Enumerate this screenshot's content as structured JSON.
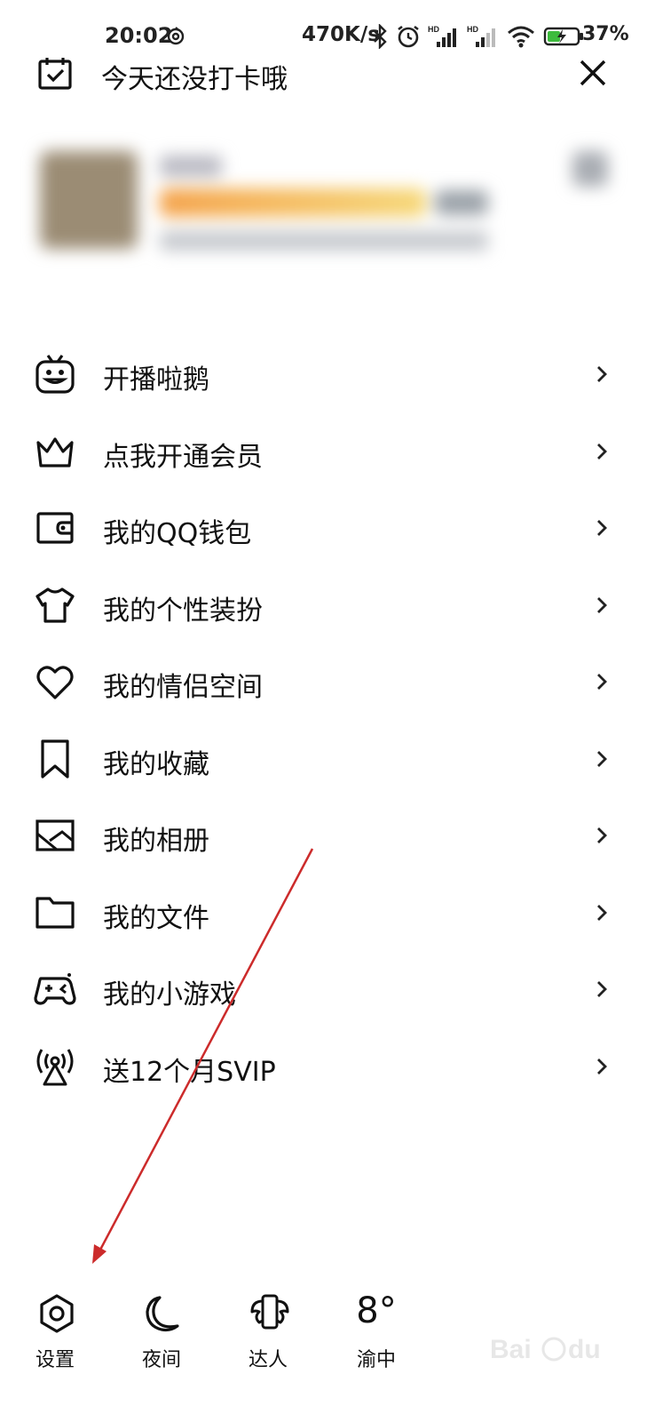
{
  "status_bar": {
    "time": "20:02",
    "net_speed": "470K/s",
    "battery_percent": "37%",
    "icons": [
      "bluetooth-icon",
      "alarm-icon",
      "signal-hd-icon",
      "signal-hd-icon",
      "wifi-icon",
      "battery-charging-icon"
    ]
  },
  "header": {
    "checkin_text": "今天还没打卡哦"
  },
  "menu": {
    "items": [
      {
        "label": "开播啦鹅",
        "icon": "tv-mascot-icon"
      },
      {
        "label": "点我开通会员",
        "icon": "crown-icon"
      },
      {
        "label": "我的QQ钱包",
        "icon": "wallet-icon"
      },
      {
        "label": "我的个性装扮",
        "icon": "tshirt-icon"
      },
      {
        "label": "我的情侣空间",
        "icon": "heart-icon"
      },
      {
        "label": "我的收藏",
        "icon": "bookmark-icon"
      },
      {
        "label": "我的相册",
        "icon": "photo-icon"
      },
      {
        "label": "我的文件",
        "icon": "folder-icon"
      },
      {
        "label": "我的小游戏",
        "icon": "gamepad-icon"
      },
      {
        "label": "送12个月SVIP",
        "icon": "broadcast-icon"
      }
    ]
  },
  "bottom_bar": {
    "settings_label": "设置",
    "night_label": "夜间",
    "expert_label": "达人",
    "weather_temp": "8°",
    "weather_city": "渝中"
  },
  "colors": {
    "annotation_arrow": "#cc2b2b",
    "text": "#111111"
  }
}
